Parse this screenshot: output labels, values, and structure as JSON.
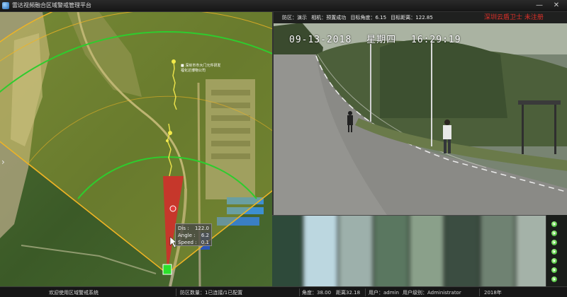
{
  "window": {
    "title": "雷达视频融合区域警戒管理平台",
    "minimize": "—",
    "close": "✕"
  },
  "watermark": "深圳云盾卫士  未注册",
  "map": {
    "poi_line1": "■ 深圳市市大门元件研发",
    "poi_line2": "福化达博物公司",
    "side_arrow": "›",
    "tooltip": {
      "dis_label": "Dis :",
      "dis_value": "122.0",
      "angle_label": "Angle :",
      "angle_value": "6.2",
      "speed_label": "Speed :",
      "speed_value": "0.1"
    }
  },
  "camera": {
    "header": {
      "zone": "防区：演示",
      "camera": "相机：预置成功",
      "target_angle": "目标角度：6.15",
      "target_distance": "目标距离：122.85"
    },
    "osd": {
      "date": "09-13-2018",
      "weekday": "星期四",
      "time": "16:29:19"
    }
  },
  "statusbar": {
    "welcome": "欢迎使用区域警戒系统",
    "zones": "防区数量：1已连接/1已配置",
    "angle": "角度：38.00",
    "distance": "距离32.18",
    "user": "用户：admin",
    "user_level": "用户级别：Administrator",
    "year": "2018年"
  },
  "colors": {
    "sector_fill": "#c9c23a",
    "sector_edge": "#f0b424",
    "range_ring": "#2ecc2e",
    "target_beam": "#d62a2a",
    "track": "#e8e04a",
    "rail_button": "#2bb320"
  }
}
